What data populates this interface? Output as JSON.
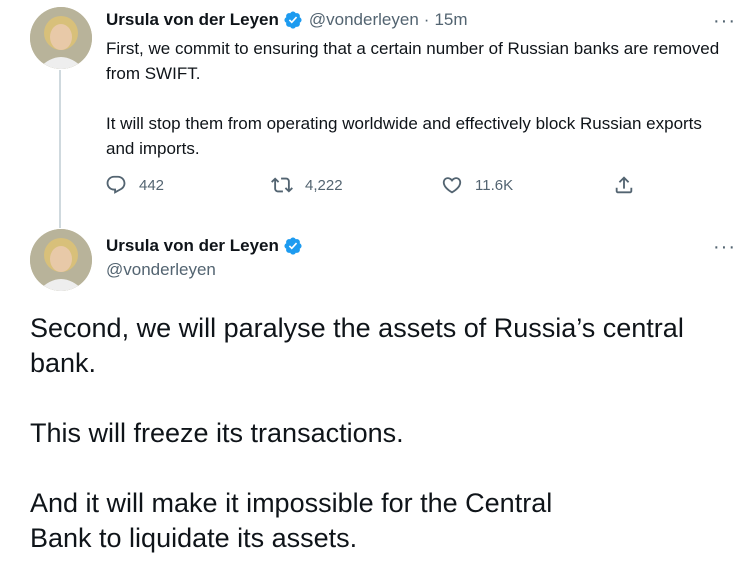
{
  "tweet1": {
    "author_name": "Ursula von der Leyen",
    "handle": "@vonderleyen",
    "separator": "·",
    "time": "15m",
    "text_para1": "First, we commit to ensuring that a certain number of Russian banks are removed from SWIFT.",
    "text_para2": "It will stop them from operating worldwide and effectively block Russian exports and imports.",
    "replies": "442",
    "retweets": "4,222",
    "likes": "11.6K",
    "more": "···"
  },
  "tweet2": {
    "author_name": "Ursula von der Leyen",
    "handle": "@vonderleyen",
    "more": "···",
    "text_para1": "Second, we will paralyse the assets of Russia’s central bank.",
    "text_para2": "This will freeze its transactions.",
    "text_para3": "And it will make it impossible for the Central Bank to liquidate its assets."
  },
  "colors": {
    "verified": "#1d9bf0",
    "secondary_text": "#536471",
    "thread_line": "#cfd9de"
  },
  "icons": [
    "verified-badge-icon",
    "reply-icon",
    "retweet-icon",
    "like-icon",
    "share-icon",
    "more-icon"
  ]
}
